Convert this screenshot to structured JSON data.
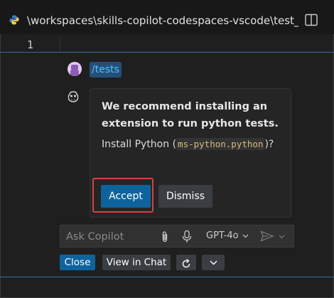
{
  "editor": {
    "tab_title": "\\workspaces\\skills-copilot-codespaces-vscode\\test_ap",
    "line_number": "1"
  },
  "chat": {
    "request_command": "/tests",
    "response": {
      "heading": "We recommend installing an extension to run python tests.",
      "body_prefix": "Install Python (",
      "extension_id": "ms-python.python",
      "body_suffix": ")?",
      "accept_label": "Accept",
      "dismiss_label": "Dismiss"
    },
    "input": {
      "placeholder": "Ask Copilot",
      "model": "GPT-4o"
    },
    "actions": {
      "close_label": "Close",
      "view_in_chat_label": "View in Chat"
    }
  },
  "colors": {
    "accent": "#0e639c",
    "highlight_ring": "#d84141",
    "command_text": "#4fc1ff"
  },
  "icons": [
    "python-icon",
    "split-editor-icon",
    "user-avatar",
    "copilot-icon",
    "attach-icon",
    "mic-icon",
    "send-icon",
    "chevron-down-icon",
    "rerun-icon"
  ]
}
